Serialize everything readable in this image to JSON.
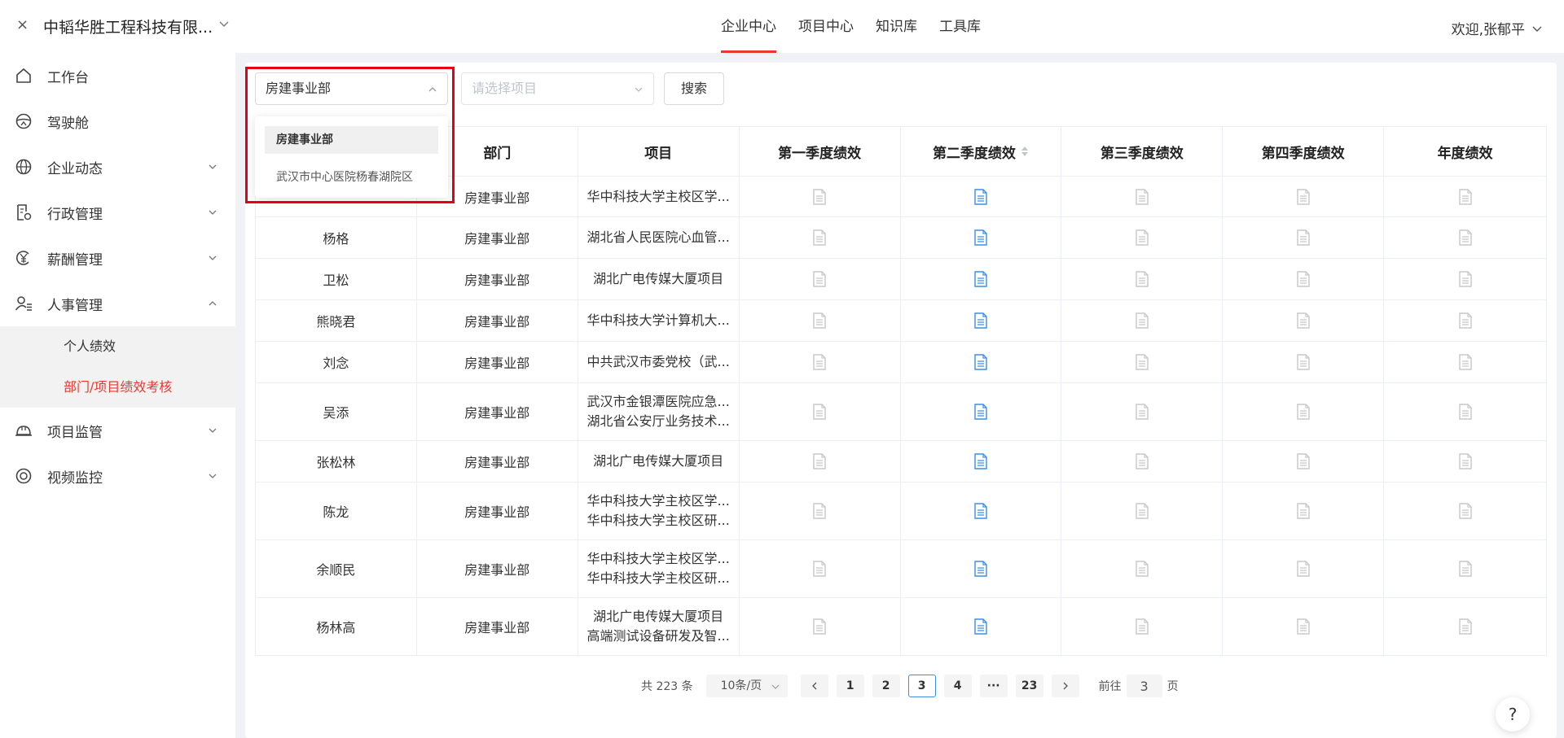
{
  "topbar": {
    "close_glyph": "×",
    "company": "中韬华胜工程科技有限...",
    "nav": [
      "企业中心",
      "项目中心",
      "知识库",
      "工具库"
    ],
    "active_nav": 0,
    "welcome": "欢迎,张郁平"
  },
  "sidebar": {
    "items": [
      {
        "label": "工作台",
        "icon": "home-icon"
      },
      {
        "label": "驾驶舱",
        "icon": "steering-wheel-icon"
      },
      {
        "label": "企业动态",
        "icon": "globe-icon"
      },
      {
        "label": "行政管理",
        "icon": "document-gear-icon"
      },
      {
        "label": "薪酬管理",
        "icon": "yen-icon"
      },
      {
        "label": "人事管理",
        "icon": "user-list-icon"
      },
      {
        "label": "项目监管",
        "icon": "hardhat-icon"
      },
      {
        "label": "视频监控",
        "icon": "camera-icon"
      }
    ],
    "submenu": [
      "个人绩效",
      "部门/项目绩效考核"
    ],
    "active_sub": 1
  },
  "filters": {
    "dept_value": "房建事业部",
    "project_placeholder": "请选择项目",
    "search_label": "搜索"
  },
  "dropdown": {
    "options": [
      "房建事业部",
      "武汉市中心医院杨春湖院区"
    ],
    "selected": 0
  },
  "table": {
    "headers": [
      "",
      "部门",
      "项目",
      "第一季度绩效",
      "第二季度绩效",
      "第三季度绩效",
      "第四季度绩效",
      "年度绩效"
    ],
    "rows": [
      {
        "name": "",
        "dept": "房建事业部",
        "projects": [
          "华中科技大学主校区学..."
        ]
      },
      {
        "name": "杨格",
        "dept": "房建事业部",
        "projects": [
          "湖北省人民医院心血管..."
        ]
      },
      {
        "name": "卫松",
        "dept": "房建事业部",
        "projects": [
          "湖北广电传媒大厦项目"
        ]
      },
      {
        "name": "熊晓君",
        "dept": "房建事业部",
        "projects": [
          "华中科技大学计算机大..."
        ]
      },
      {
        "name": "刘念",
        "dept": "房建事业部",
        "projects": [
          "中共武汉市委党校（武..."
        ]
      },
      {
        "name": "吴添",
        "dept": "房建事业部",
        "projects": [
          "武汉市金银潭医院应急...",
          "湖北省公安厅业务技术..."
        ]
      },
      {
        "name": "张松林",
        "dept": "房建事业部",
        "projects": [
          "湖北广电传媒大厦项目"
        ]
      },
      {
        "name": "陈龙",
        "dept": "房建事业部",
        "projects": [
          "华中科技大学主校区学...",
          "华中科技大学主校区研..."
        ]
      },
      {
        "name": "余顺民",
        "dept": "房建事业部",
        "projects": [
          "华中科技大学主校区学...",
          "华中科技大学主校区研..."
        ]
      },
      {
        "name": "杨林高",
        "dept": "房建事业部",
        "projects": [
          "湖北广电传媒大厦项目",
          "高端测试设备研发及智..."
        ]
      }
    ],
    "active_quarter_color": "#3a8ee6",
    "inactive_icon_color": "#c8c8c8"
  },
  "pagination": {
    "total": "共 223 条",
    "page_size": "10条/页",
    "pages": [
      "1",
      "2",
      "3",
      "4",
      "···",
      "23"
    ],
    "current": "3",
    "goto_label": "前往",
    "goto_value": "3",
    "page_suffix": "页"
  },
  "help": "?"
}
